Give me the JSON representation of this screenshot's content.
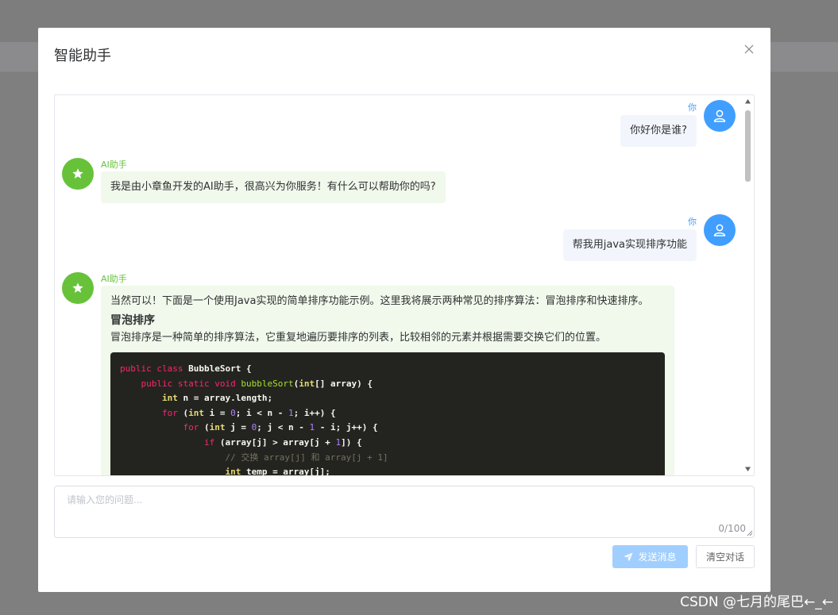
{
  "dialog": {
    "title": "智能助手"
  },
  "messages": [
    {
      "role": "user",
      "sender": "你",
      "text": "你好你是谁?"
    },
    {
      "role": "ai",
      "sender": "AI助手",
      "text": "我是由小章鱼开发的AI助手，很高兴为你服务！有什么可以帮助你的吗?"
    },
    {
      "role": "user",
      "sender": "你",
      "text": "帮我用java实现排序功能"
    },
    {
      "role": "ai",
      "sender": "AI助手",
      "intro": "当然可以！下面是一个使用Java实现的简单排序功能示例。这里我将展示两种常见的排序算法：冒泡排序和快速排序。",
      "heading": "冒泡排序",
      "description": "冒泡排序是一种简单的排序算法，它重复地遍历要排序的列表，比较相邻的元素并根据需要交换它们的位置。",
      "code": [
        "public class BubbleSort {",
        "    public static void bubbleSort(int[] array) {",
        "        int n = array.length;",
        "        for (int i = 0; i < n - 1; i++) {",
        "            for (int j = 0; j < n - 1 - i; j++) {",
        "                if (array[j] > array[j + 1]) {",
        "                    // 交换 array[j] 和 array[j + 1]",
        "                    int temp = array[j];"
      ]
    }
  ],
  "input": {
    "placeholder": "请输入您的问题...",
    "value": "",
    "word_count": "0/100"
  },
  "buttons": {
    "send_label": "发送消息",
    "clear_label": "清空对话"
  },
  "icons": {
    "close": "close-icon",
    "user_avatar": "user-icon",
    "ai_avatar": "star-icon",
    "send": "send-icon"
  },
  "colors": {
    "user_accent": "#409eff",
    "ai_accent": "#67c23a",
    "user_bubble": "#f2f6fc",
    "ai_bubble": "#f0f9eb",
    "send_button": "#a0cfff",
    "code_bg": "#23241f"
  },
  "watermark": "CSDN @七月的尾巴←_←"
}
